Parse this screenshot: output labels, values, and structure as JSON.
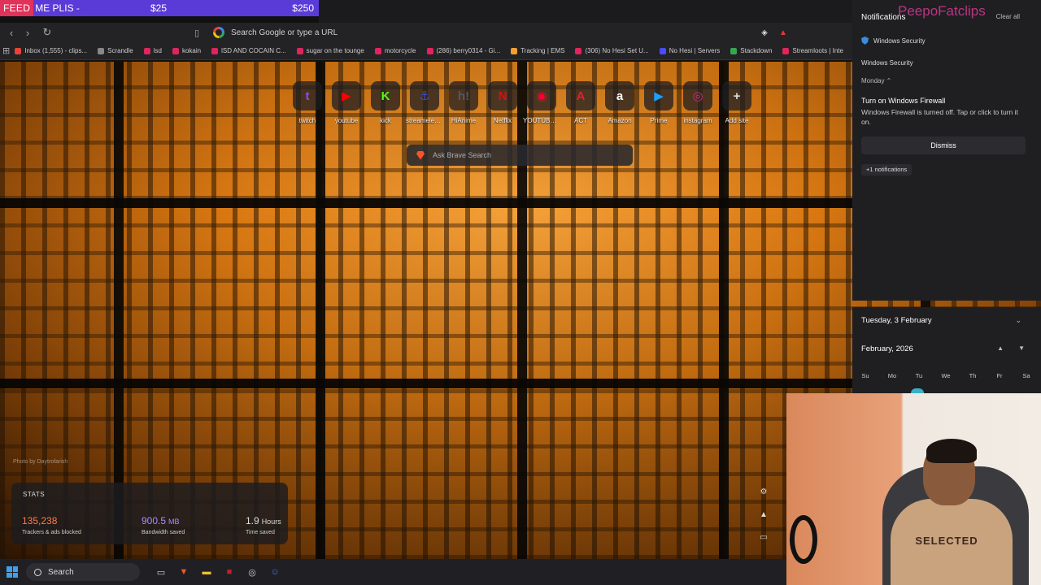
{
  "stream_overlay": {
    "feed_label": "FEED",
    "feed_rest": " ME PLIS -",
    "amount_current": "$25",
    "amount_goal": "$250"
  },
  "toolbar": {
    "omnibox_placeholder": "Search Google or type a URL",
    "back_icon": "back-arrow-icon",
    "forward_icon": "forward-arrow-icon",
    "reload_icon": "reload-icon",
    "bookmark_icon": "bookmark-icon"
  },
  "bookmarks": [
    {
      "label": "Inbox (1,555) - clips...",
      "color": "#ea4335"
    },
    {
      "label": "Scrandle",
      "color": "#888888"
    },
    {
      "label": "lsd",
      "color": "#e0245e"
    },
    {
      "label": "kokain",
      "color": "#e0245e"
    },
    {
      "label": "lSD AND COCAIN C...",
      "color": "#e0245e"
    },
    {
      "label": "sugar on the tounge",
      "color": "#e0245e"
    },
    {
      "label": "motorcycle",
      "color": "#e0245e"
    },
    {
      "label": "(286) berry0314 - Gi...",
      "color": "#e0245e"
    },
    {
      "label": "Tracking | EMS",
      "color": "#f0a030"
    },
    {
      "label": "(306) No Hesi Set U...",
      "color": "#e0245e"
    },
    {
      "label": "No Hesi | Servers",
      "color": "#4a4aff"
    },
    {
      "label": "Stackdown",
      "color": "#36a64f"
    },
    {
      "label": "Streamloots | Inte",
      "color": "#e0245e"
    }
  ],
  "top_sites": [
    {
      "label": "twitch",
      "glyph": "t",
      "color": "#9146ff"
    },
    {
      "label": "youtube",
      "glyph": "▶",
      "color": "#ff0000"
    },
    {
      "label": "kick",
      "glyph": "K",
      "color": "#53fc18"
    },
    {
      "label": "streamelem...",
      "glyph": "⚓",
      "color": "#3a4bd8"
    },
    {
      "label": "HiAnime",
      "glyph": "h!",
      "color": "#555566"
    },
    {
      "label": "Netflix",
      "glyph": "N",
      "color": "#e50914"
    },
    {
      "label": "YOUTUBE ...",
      "glyph": "◉",
      "color": "#ff0033"
    },
    {
      "label": "ACT",
      "glyph": "A",
      "color": "#e02030"
    },
    {
      "label": "Amazon",
      "glyph": "a",
      "color": "#ffffff"
    },
    {
      "label": "Prime",
      "glyph": "▶",
      "color": "#1aa0ff"
    },
    {
      "label": "instagram",
      "glyph": "◎",
      "color": "#d62976"
    },
    {
      "label": "Add site",
      "glyph": "+",
      "color": "#dddddd"
    }
  ],
  "brave_search": {
    "placeholder": "Ask Brave Search"
  },
  "photo_credit": "Photo by Daytrofarish",
  "stats": {
    "title": "STATS",
    "trackers": {
      "value": "135,238",
      "caption": "Trackers & ads blocked",
      "color": "#ff7a4d"
    },
    "bandwidth": {
      "value": "900.5",
      "unit": "MB",
      "caption": "Bandwidth saved",
      "color": "#a98bff"
    },
    "time": {
      "value": "1.9",
      "unit": "Hours",
      "caption": "Time saved",
      "color": "#ffffff"
    }
  },
  "notifications": {
    "header": "Notifications",
    "clear_all": "Clear all",
    "app_name": "Windows Security",
    "group_name": "Windows Security",
    "when": "Monday ⌃",
    "title": "Turn on Windows Firewall",
    "body": "Windows Firewall is turned off. Tap or click to turn it on.",
    "dismiss": "Dismiss",
    "more": "+1 notifications"
  },
  "watermark": "PeepoFatclips",
  "calendar": {
    "date": "Tuesday, 3 February",
    "month": "February, 2026",
    "weekdays": [
      "Su",
      "Mo",
      "Tu",
      "We",
      "Th",
      "Fr",
      "Sa"
    ]
  },
  "webcam": {
    "shirt_text": "SELECTED"
  },
  "taskbar": {
    "search_label": "Search",
    "apps": [
      {
        "name": "task-view-icon",
        "glyph": "▭",
        "color": "#cccccc"
      },
      {
        "name": "brave-icon",
        "glyph": "▼",
        "color": "#fb542b"
      },
      {
        "name": "file-explorer-icon",
        "glyph": "▬",
        "color": "#f2c230"
      },
      {
        "name": "app-red-icon",
        "glyph": "■",
        "color": "#c0202a"
      },
      {
        "name": "steering-icon",
        "glyph": "◎",
        "color": "#cccccc"
      },
      {
        "name": "discord-icon",
        "glyph": "☺",
        "color": "#5865f2"
      }
    ]
  }
}
